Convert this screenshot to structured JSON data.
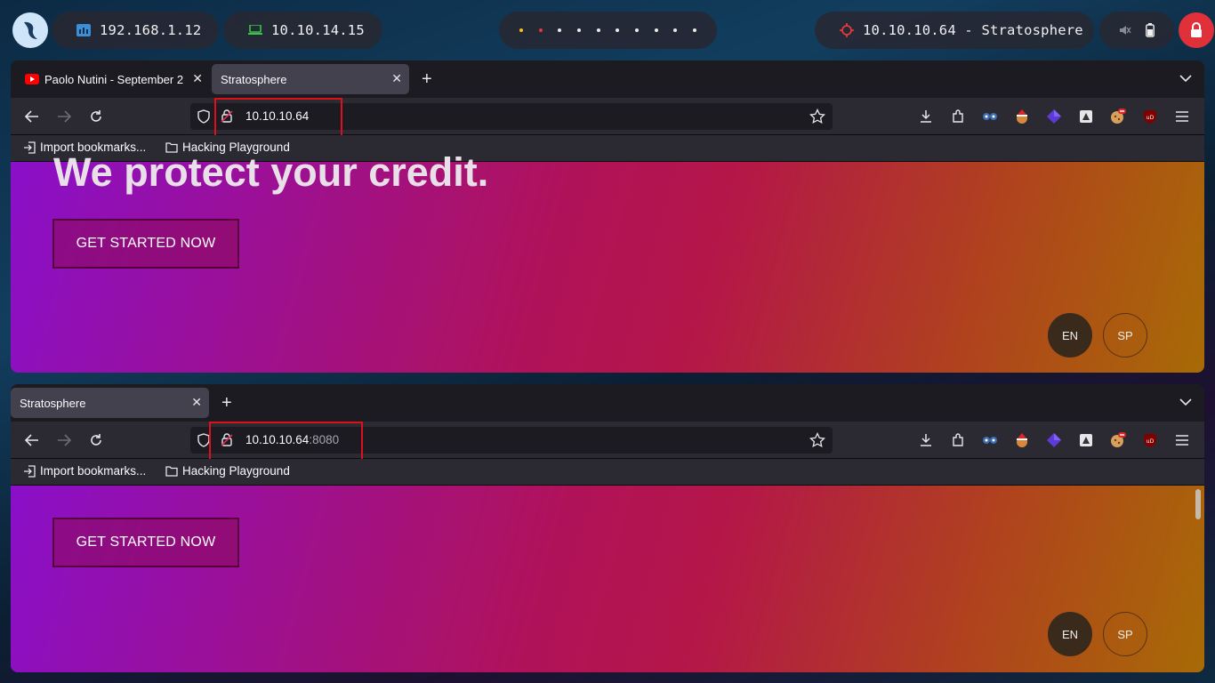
{
  "panel": {
    "local_ip": "192.168.1.12",
    "vpn_ip": "10.10.14.15",
    "target": "10.10.10.64 - Stratosphere",
    "workspace_dots": [
      "yellow",
      "red",
      "white",
      "white",
      "white",
      "white",
      "white",
      "white",
      "white",
      "white"
    ]
  },
  "window1": {
    "tabs": [
      {
        "label": "Paolo Nutini - September 2",
        "close": "✕"
      },
      {
        "label": "Stratosphere",
        "close": "✕"
      }
    ],
    "new_tab": "+",
    "url_host": "10.10.10.64",
    "url_port": "",
    "bookmarks": [
      "Import bookmarks...",
      "Hacking Playground"
    ],
    "hero": "We protect your credit.",
    "cta": "GET STARTED NOW",
    "lang_en": "EN",
    "lang_sp": "SP"
  },
  "window2": {
    "tabs": [
      {
        "label": "Stratosphere",
        "close": "✕"
      }
    ],
    "new_tab": "+",
    "url_host": "10.10.10.64",
    "url_port": ":8080",
    "bookmarks": [
      "Import bookmarks...",
      "Hacking Playground"
    ],
    "cta": "GET STARTED NOW",
    "lang_en": "EN",
    "lang_sp": "SP"
  },
  "colors": {
    "highlight_box": "#e0101a",
    "accent_power": "#e0313a"
  }
}
